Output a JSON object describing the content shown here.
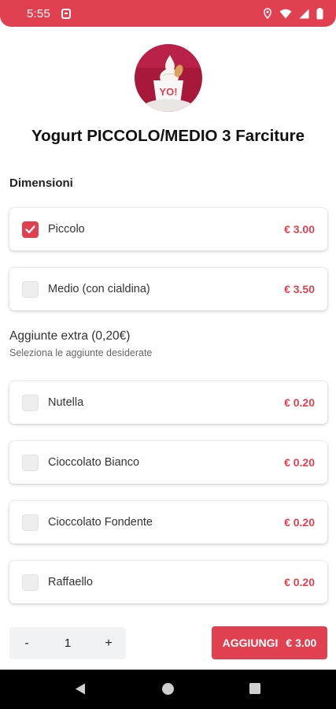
{
  "status_bar": {
    "time": "5:55",
    "color": "#e0404f"
  },
  "product": {
    "title": "Yogurt PICCOLO/MEDIO 3 Farciture",
    "logo_text": "YO!"
  },
  "sections": {
    "size_title": "Dimensioni",
    "extras_title": "Aggiunte extra (0,20€)",
    "extras_subtitle": "Seleziona le aggiunte desiderate"
  },
  "size_options": [
    {
      "label": "Piccolo",
      "price": "€ 3.00",
      "checked": true
    },
    {
      "label": "Medio (con cialdina)",
      "price": "€ 3.50",
      "checked": false
    }
  ],
  "extra_options": [
    {
      "label": "Nutella",
      "price": "€ 0.20",
      "checked": false
    },
    {
      "label": "Cioccolato Bianco",
      "price": "€ 0.20",
      "checked": false
    },
    {
      "label": "Cioccolato Fondente",
      "price": "€ 0.20",
      "checked": false
    },
    {
      "label": "Raffaello",
      "price": "€ 0.20",
      "checked": false
    }
  ],
  "footer": {
    "minus_label": "-",
    "quantity": "1",
    "plus_label": "+",
    "add_label": "AGGIUNGI",
    "add_price": "€ 3.00"
  },
  "icons": {
    "status": [
      "location-icon",
      "wifi-icon",
      "signal-icon",
      "battery-icon"
    ],
    "nav": [
      "back-icon",
      "home-icon",
      "recents-icon"
    ]
  },
  "accent_color": "#e0404f"
}
